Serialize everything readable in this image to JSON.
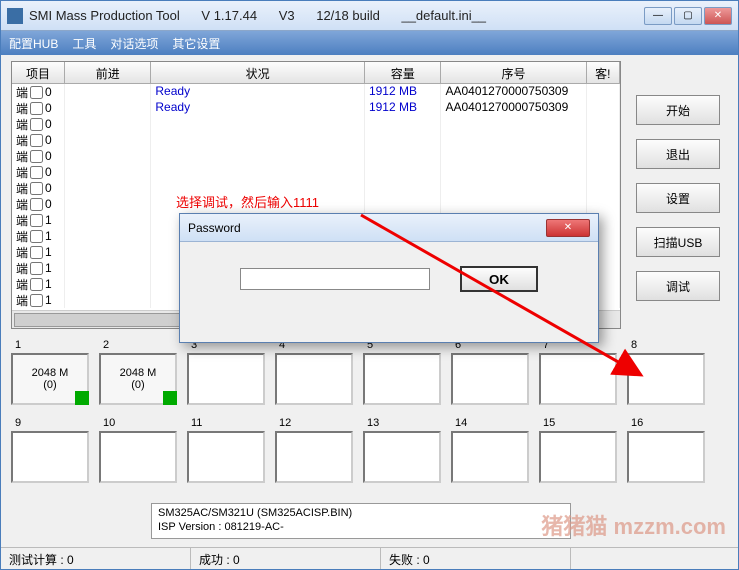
{
  "titlebar": {
    "app_name": "SMI Mass Production Tool",
    "version": "V 1.17.44",
    "v3": "V3",
    "build": "12/18 build",
    "ini": "__default.ini__"
  },
  "menu": {
    "hub": "配置HUB",
    "tool": "工具",
    "dialog": "对话选项",
    "other": "其它设置"
  },
  "table": {
    "headers": {
      "item": "项目",
      "progress": "前进",
      "status": "状况",
      "capacity": "容量",
      "serial": "序号",
      "cust": "客!"
    },
    "rows": [
      {
        "port": "端",
        "n": "0",
        "status": "Ready",
        "cap": "1912 MB",
        "serial": "AA0401270000750309"
      },
      {
        "port": "端",
        "n": "0",
        "status": "Ready",
        "cap": "1912 MB",
        "serial": "AA0401270000750309"
      },
      {
        "port": "端",
        "n": "0"
      },
      {
        "port": "端",
        "n": "0"
      },
      {
        "port": "端",
        "n": "0"
      },
      {
        "port": "端",
        "n": "0"
      },
      {
        "port": "端",
        "n": "0"
      },
      {
        "port": "端",
        "n": "0"
      },
      {
        "port": "端",
        "n": "1"
      },
      {
        "port": "端",
        "n": "1"
      },
      {
        "port": "端",
        "n": "1"
      },
      {
        "port": "端",
        "n": "1"
      },
      {
        "port": "端",
        "n": "1"
      },
      {
        "port": "端",
        "n": "1"
      }
    ]
  },
  "hint": "选择调试，然后输入1111",
  "buttons": {
    "start": "开始",
    "exit": "退出",
    "settings": "设置",
    "scan": "扫描USB",
    "debug": "调试"
  },
  "slots": {
    "numbers": [
      "1",
      "2",
      "3",
      "4",
      "5",
      "6",
      "7",
      "8",
      "9",
      "10",
      "11",
      "12",
      "13",
      "14",
      "15",
      "16"
    ],
    "filled": {
      "line1": "2048 M",
      "line2": "(0)"
    }
  },
  "chip": {
    "line1": "SM325AC/SM321U          (SM325ACISP.BIN)",
    "line2": "ISP Version :   081219-AC-"
  },
  "status": {
    "test": "测试计算 : 0",
    "ok": "成功 : 0",
    "fail": "失败 : 0"
  },
  "dialog": {
    "title": "Password",
    "ok": "OK",
    "placeholder": ""
  },
  "watermark": "猪猪猫 mzzm.com"
}
